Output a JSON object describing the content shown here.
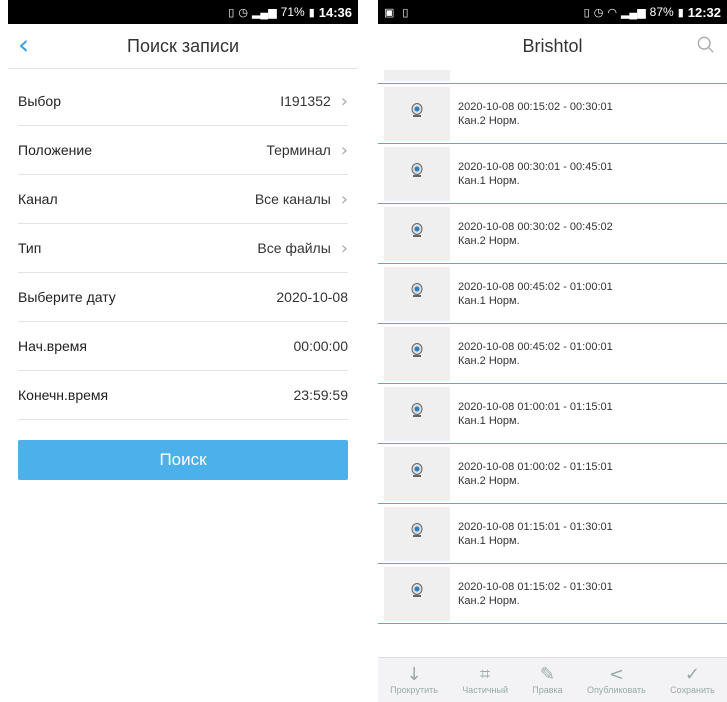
{
  "left": {
    "status": {
      "battery": "71%",
      "time": "14:36"
    },
    "title": "Поиск записи",
    "rows": [
      {
        "label": "Выбор",
        "value": "I191352",
        "chevron": true
      },
      {
        "label": "Положение",
        "value": "Терминал",
        "chevron": true
      },
      {
        "label": "Канал",
        "value": "Все каналы",
        "chevron": true
      },
      {
        "label": "Тип",
        "value": "Все файлы",
        "chevron": true
      },
      {
        "label": "Выберите дату",
        "value": "2020-10-08",
        "chevron": false
      },
      {
        "label": "Нач.время",
        "value": "00:00:00",
        "chevron": false
      },
      {
        "label": "Конечн.время",
        "value": "23:59:59",
        "chevron": false
      }
    ],
    "search_button": "Поиск",
    "accent": "#4cb1ea"
  },
  "right": {
    "status": {
      "battery": "87%",
      "time": "12:32"
    },
    "title": "Brishtol",
    "items": [
      {
        "time": "2020-10-08   00:15:02 - 00:30:01",
        "sub": "Кан.2  Норм."
      },
      {
        "time": "2020-10-08   00:30:01 - 00:45:01",
        "sub": "Кан.1  Норм."
      },
      {
        "time": "2020-10-08   00:30:02 - 00:45:02",
        "sub": "Кан.2  Норм."
      },
      {
        "time": "2020-10-08   00:45:02 - 01:00:01",
        "sub": "Кан.1  Норм."
      },
      {
        "time": "2020-10-08   00:45:02 - 01:00:01",
        "sub": "Кан.2  Норм."
      },
      {
        "time": "2020-10-08   01:00:01 - 01:15:01",
        "sub": "Кан.1  Норм."
      },
      {
        "time": "2020-10-08   01:00:02 - 01:15:01",
        "sub": "Кан.2  Норм."
      },
      {
        "time": "2020-10-08   01:15:01 - 01:30:01",
        "sub": "Кан.1  Норм."
      },
      {
        "time": "2020-10-08   01:15:02 - 01:30:01",
        "sub": "Кан.2  Норм."
      }
    ],
    "toolbar": [
      {
        "label": "Прокрутить",
        "icon": "arrow-down-icon"
      },
      {
        "label": "Частичный",
        "icon": "crop-icon"
      },
      {
        "label": "Правка",
        "icon": "pen-icon"
      },
      {
        "label": "Опубликовать",
        "icon": "share-icon"
      },
      {
        "label": "Сохранить",
        "icon": "check-icon"
      }
    ]
  }
}
